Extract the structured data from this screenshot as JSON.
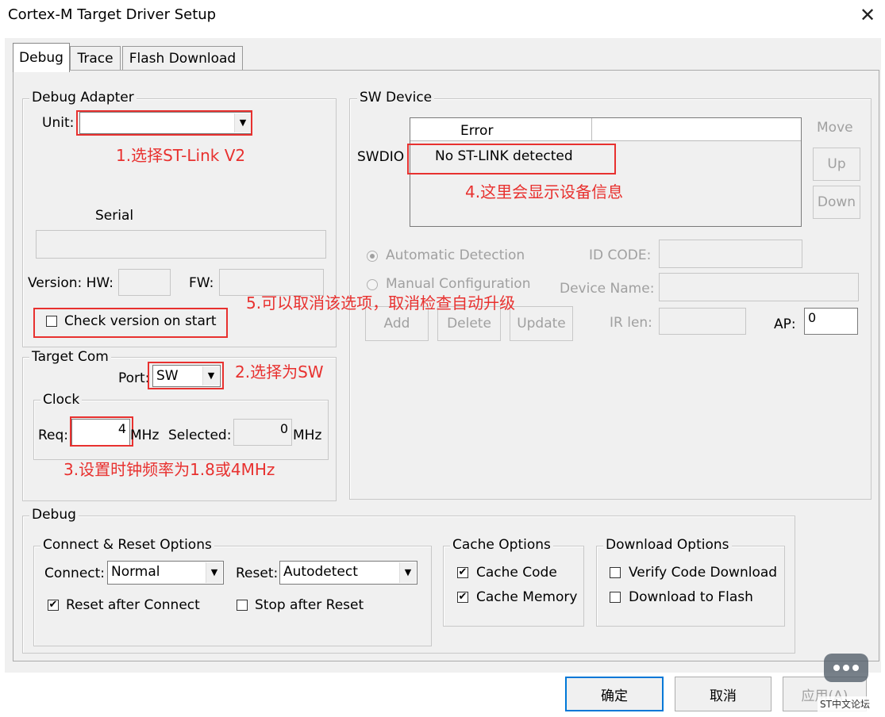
{
  "window": {
    "title": "Cortex-M Target Driver Setup",
    "close_glyph": "✕"
  },
  "tabs": [
    {
      "label": "Debug"
    },
    {
      "label": "Trace"
    },
    {
      "label": "Flash Download"
    }
  ],
  "debug_adapter": {
    "legend": "Debug Adapter",
    "unit_label": "Unit:",
    "unit_value": "",
    "serial_label": "Serial",
    "serial_value": "",
    "version_label": "Version: HW:",
    "hw_value": "",
    "fw_label": "FW:",
    "fw_value": "",
    "check_version_label": "Check version on start",
    "check_version_checked": false
  },
  "target_com": {
    "legend": "Target Com",
    "port_label": "Port:",
    "port_value": "SW",
    "clock_legend": "Clock",
    "req_label": "Req:",
    "req_value": "4",
    "req_unit": "MHz",
    "selected_label": "Selected:",
    "selected_value": "0",
    "selected_unit": "MHz"
  },
  "sw_device": {
    "legend": "SW Device",
    "col_header": "Error",
    "row_label": "SWDIO",
    "row_value": "No ST-LINK detected",
    "move_label": "Move",
    "up_label": "Up",
    "down_label": "Down",
    "auto_detect_label": "Automatic Detection",
    "manual_config_label": "Manual Configuration",
    "id_code_label": "ID CODE:",
    "device_name_label": "Device Name:",
    "ir_len_label": "IR len:",
    "ap_label": "AP:",
    "ap_value": "0",
    "add_label": "Add",
    "delete_label": "Delete",
    "update_label": "Update"
  },
  "debug_group": {
    "legend": "Debug",
    "connect_reset_legend": "Connect & Reset Options",
    "connect_label": "Connect:",
    "connect_value": "Normal",
    "reset_label": "Reset:",
    "reset_value": "Autodetect",
    "reset_after_connect_label": "Reset after Connect",
    "reset_after_connect_checked": true,
    "stop_after_reset_label": "Stop after Reset",
    "stop_after_reset_checked": false,
    "cache_legend": "Cache Options",
    "cache_code_label": "Cache Code",
    "cache_code_checked": true,
    "cache_memory_label": "Cache Memory",
    "cache_memory_checked": true,
    "download_legend": "Download Options",
    "verify_label": "Verify Code Download",
    "verify_checked": false,
    "download_flash_label": "Download to Flash",
    "download_flash_checked": false
  },
  "footer": {
    "ok_label": "确定",
    "cancel_label": "取消",
    "apply_label": "应用(A)",
    "watermark": "ST中文论坛"
  },
  "annotations": {
    "a1": "1.选择ST-Link V2",
    "a2": "2.选择为SW",
    "a3": "3.设置时钟频率为1.8或4MHz",
    "a4": "4.这里会显示设备信息",
    "a5": "5.可以取消该选项，取消检查自动升级"
  },
  "colors": {
    "annotation": "#e8312f",
    "panel": "#f0f0f0",
    "disabled_text": "#a0a0a0"
  }
}
